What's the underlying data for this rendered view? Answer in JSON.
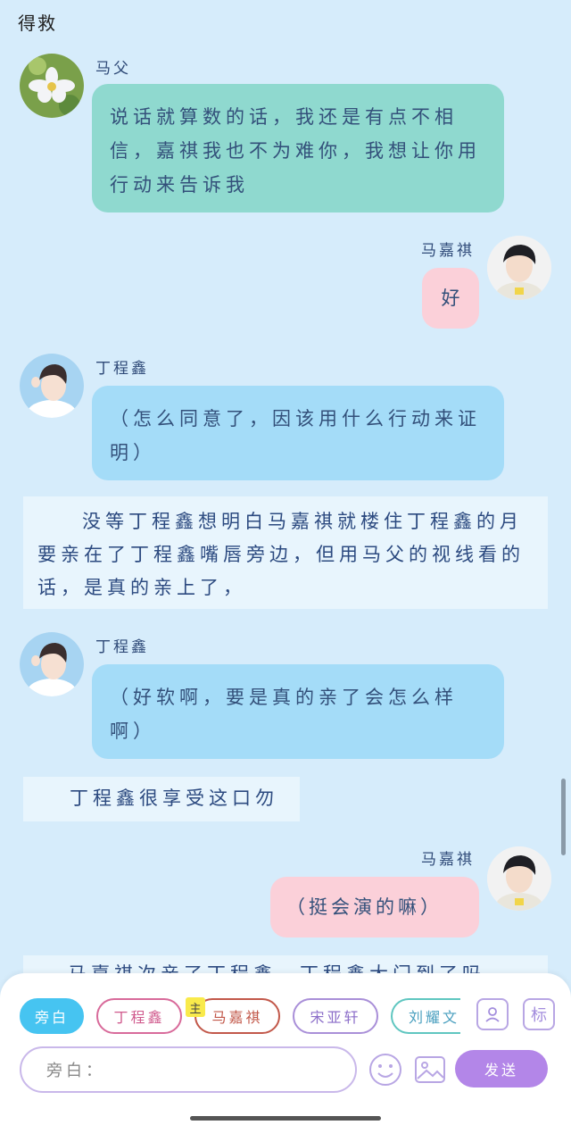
{
  "header": {
    "title": "得救"
  },
  "messages": [
    {
      "speaker": "马父",
      "text": "说话就算数的话，我还是有点不相信，嘉祺我也不为难你，我想让你用行动来告诉我"
    },
    {
      "speaker": "马嘉祺",
      "text": "好"
    },
    {
      "speaker": "丁程鑫",
      "text": "（怎么同意了，因该用什么行动来证明）"
    },
    {
      "narration": "没等丁程鑫想明白马嘉祺就楼住丁程鑫的月要亲在了丁程鑫嘴唇旁边，但用马父的视线看的话，是真的亲上了，"
    },
    {
      "speaker": "丁程鑫",
      "text": "（好软啊，要是真的亲了会怎么样啊）"
    },
    {
      "narration": "丁程鑫很享受这口勿"
    },
    {
      "speaker": "马嘉祺",
      "text": "（挺会演的嘛）"
    },
    {
      "narration": "马嘉祺次亲了丁程鑫，丁程鑫大门到了吗"
    }
  ],
  "composer": {
    "roles": [
      "旁白",
      "丁程鑫",
      "马嘉祺",
      "宋亚轩",
      "刘耀文"
    ],
    "main_tag": "主",
    "tag_button": "标",
    "input_placeholder": "旁白：",
    "send_label": "发送"
  }
}
